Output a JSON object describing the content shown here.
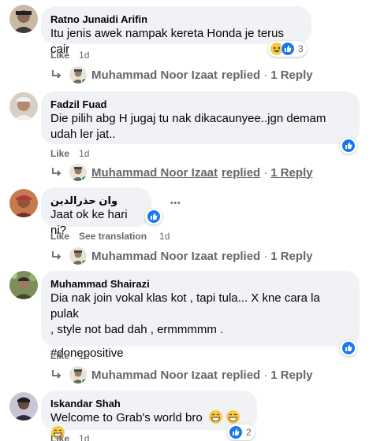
{
  "comments": [
    {
      "author": "Ratno Junaidi Arifin",
      "text": "Itu jenis awek nampak kereta Honda je terus cair",
      "like_label": "Like",
      "time": "1d",
      "reactions": {
        "icons": [
          "haha-icon",
          "like-icon"
        ],
        "count": "3"
      },
      "reply": {
        "name": "Muhammad Noor Izaat",
        "verb": "replied",
        "sep": "·",
        "count": "1 Reply"
      }
    },
    {
      "author": "Fadzil Fuad",
      "text_line1": "Die pilih abg H jugaj tu nak dikacaunyee..jgn demam",
      "text_line2": "udah ler jat..",
      "like_label": "Like",
      "time": "1d",
      "reactions": {
        "icons": [
          "like-icon"
        ]
      },
      "reply": {
        "name": "Muhammad Noor Izaat",
        "verb": "replied",
        "sep": "·",
        "count": "1 Reply"
      }
    },
    {
      "author": "وان حذرالدين",
      "text": "Jaat ok ke hari ni?",
      "like_label": "Like",
      "translation_label": "See translation",
      "time": "1d",
      "more": "•••",
      "reactions": {
        "icons": [
          "like-icon"
        ]
      },
      "reply": {
        "name": "Muhammad Noor Izaat",
        "verb": "replied",
        "sep": "·",
        "count": "1 Reply"
      }
    },
    {
      "author": "Muhammad Shairazi",
      "text_line1": "Dia nak join vokal klas kot , tapi tula... X kne cara la pulak",
      "text_line2": ", style not bad dah , ermmmmm .",
      "hashtag": "#donepositive",
      "like_label": "Like",
      "time": "1d",
      "reactions": {
        "icons": [
          "like-icon"
        ]
      },
      "reply": {
        "name": "Muhammad Noor Izaat",
        "verb": "replied",
        "sep": "·",
        "count": "1 Reply"
      }
    },
    {
      "author": "Iskandar Shah",
      "text": "Welcome to Grab's world bro",
      "emoji_count": 3,
      "like_label": "Like",
      "time": "1d",
      "reactions": {
        "icons": [
          "like-icon"
        ],
        "count": "2"
      }
    }
  ],
  "colors": {
    "bubble": "#f0f2f5",
    "meta": "#65676b",
    "like_blue": "#1877f2",
    "online_green": "#31a24c"
  }
}
